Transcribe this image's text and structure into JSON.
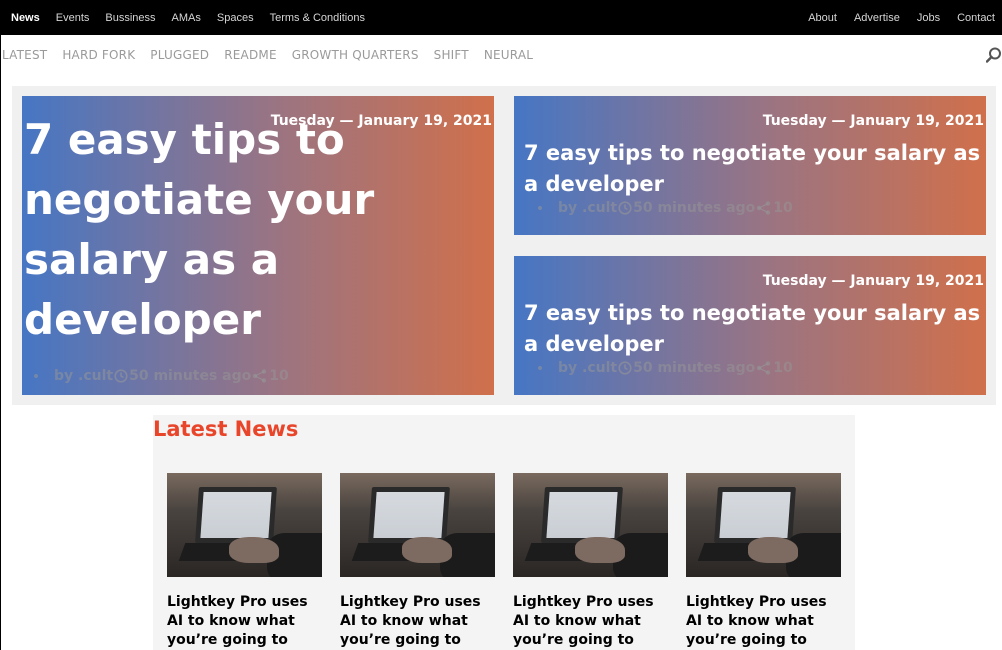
{
  "topnav": {
    "left": [
      "News",
      "Events",
      "Bussiness",
      "AMAs",
      "Spaces",
      "Terms & Conditions"
    ],
    "right": [
      "About",
      "Advertise",
      "Jobs",
      "Contact"
    ]
  },
  "subnav": {
    "categories": [
      "LATEST",
      "HARD FORK",
      "PLUGGED",
      "README",
      "GROWTH QUARTERS",
      "SHIFT",
      "NEURAL"
    ]
  },
  "hero": {
    "cards": [
      {
        "date": "Tuesday — January 19, 2021",
        "title": "7 easy tips to negotiate your salary as a developer",
        "author": "by .cult",
        "time": "50 minutes ago",
        "shares": "10"
      },
      {
        "date": "Tuesday — January 19, 2021",
        "title": "7 easy tips to negotiate your salary as a developer",
        "author": "by .cult",
        "time": "50 minutes ago",
        "shares": "10"
      },
      {
        "date": "Tuesday — January 19, 2021",
        "title": "7 easy tips to negotiate your salary as a developer",
        "author": "by .cult",
        "time": "50 minutes ago",
        "shares": "10"
      }
    ]
  },
  "latest": {
    "heading": "Latest News",
    "items": [
      {
        "headline": "Lightkey Pro uses AI to know what you’re going to type before"
      },
      {
        "headline": "Lightkey Pro uses AI to know what you’re going to type before"
      },
      {
        "headline": "Lightkey Pro uses AI to know what you’re going to type before"
      },
      {
        "headline": "Lightkey Pro uses AI to know what you’re going to type before"
      }
    ]
  },
  "colors": {
    "accent": "#e8452a",
    "gradient_start": "#4676c4",
    "gradient_end": "#d0704b",
    "topbar": "#000000"
  }
}
